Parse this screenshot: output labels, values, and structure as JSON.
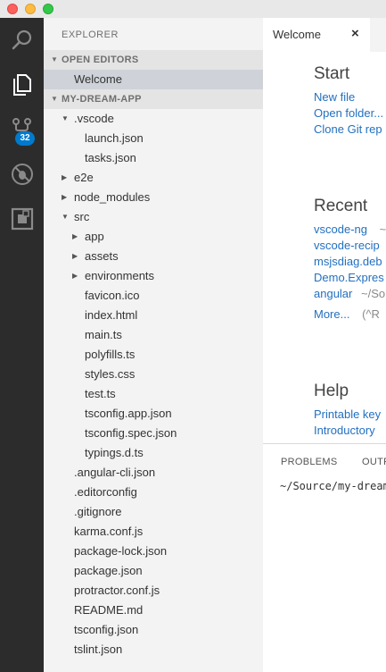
{
  "window": {
    "controls": [
      "close",
      "minimize",
      "maximize"
    ]
  },
  "activity_bar": {
    "items": [
      {
        "icon": "search-icon"
      },
      {
        "icon": "files-icon"
      },
      {
        "icon": "source-control-icon",
        "badge": "32"
      },
      {
        "icon": "debug-icon"
      },
      {
        "icon": "extensions-icon"
      }
    ],
    "badge_color": "#007acc"
  },
  "sidebar": {
    "title": "EXPLORER",
    "open_editors": {
      "header": "OPEN EDITORS",
      "items": [
        "Welcome"
      ]
    },
    "project": {
      "header": "MY-DREAM-APP",
      "tree": [
        {
          "name": ".vscode",
          "type": "folder",
          "expanded": true,
          "depth": 0
        },
        {
          "name": "launch.json",
          "type": "file",
          "depth": 1
        },
        {
          "name": "tasks.json",
          "type": "file",
          "depth": 1
        },
        {
          "name": "e2e",
          "type": "folder",
          "expanded": false,
          "depth": 0
        },
        {
          "name": "node_modules",
          "type": "folder",
          "expanded": false,
          "depth": 0
        },
        {
          "name": "src",
          "type": "folder",
          "expanded": true,
          "depth": 0
        },
        {
          "name": "app",
          "type": "folder",
          "expanded": false,
          "depth": 1
        },
        {
          "name": "assets",
          "type": "folder",
          "expanded": false,
          "depth": 1
        },
        {
          "name": "environments",
          "type": "folder",
          "expanded": false,
          "depth": 1
        },
        {
          "name": "favicon.ico",
          "type": "file",
          "depth": 1
        },
        {
          "name": "index.html",
          "type": "file",
          "depth": 1
        },
        {
          "name": "main.ts",
          "type": "file",
          "depth": 1
        },
        {
          "name": "polyfills.ts",
          "type": "file",
          "depth": 1
        },
        {
          "name": "styles.css",
          "type": "file",
          "depth": 1
        },
        {
          "name": "test.ts",
          "type": "file",
          "depth": 1
        },
        {
          "name": "tsconfig.app.json",
          "type": "file",
          "depth": 1
        },
        {
          "name": "tsconfig.spec.json",
          "type": "file",
          "depth": 1
        },
        {
          "name": "typings.d.ts",
          "type": "file",
          "depth": 1
        },
        {
          "name": ".angular-cli.json",
          "type": "file",
          "depth": 0
        },
        {
          "name": ".editorconfig",
          "type": "file",
          "depth": 0
        },
        {
          "name": ".gitignore",
          "type": "file",
          "depth": 0
        },
        {
          "name": "karma.conf.js",
          "type": "file",
          "depth": 0
        },
        {
          "name": "package-lock.json",
          "type": "file",
          "depth": 0
        },
        {
          "name": "package.json",
          "type": "file",
          "depth": 0
        },
        {
          "name": "protractor.conf.js",
          "type": "file",
          "depth": 0
        },
        {
          "name": "README.md",
          "type": "file",
          "depth": 0
        },
        {
          "name": "tsconfig.json",
          "type": "file",
          "depth": 0
        },
        {
          "name": "tslint.json",
          "type": "file",
          "depth": 0
        }
      ]
    }
  },
  "editor": {
    "tab": {
      "label": "Welcome",
      "close": "×"
    },
    "welcome": {
      "start": {
        "heading": "Start",
        "links": [
          "New file",
          "Open folder...",
          "Clone Git rep"
        ]
      },
      "recent": {
        "heading": "Recent",
        "items": [
          {
            "name": "vscode-ng",
            "path": "~"
          },
          {
            "name": "vscode-recip",
            "path": ""
          },
          {
            "name": "msjsdiag.deb",
            "path": ""
          },
          {
            "name": "Demo.Expres",
            "path": ""
          },
          {
            "name": "angular",
            "path": "~/So"
          }
        ],
        "more": {
          "label": "More...",
          "shortcut": "(^R"
        }
      },
      "help": {
        "heading": "Help",
        "links": [
          "Printable key",
          "Introductory"
        ]
      }
    },
    "panel": {
      "tabs": [
        "PROBLEMS",
        "OUTP"
      ],
      "terminal_text": "~/Source/my-dream"
    }
  }
}
